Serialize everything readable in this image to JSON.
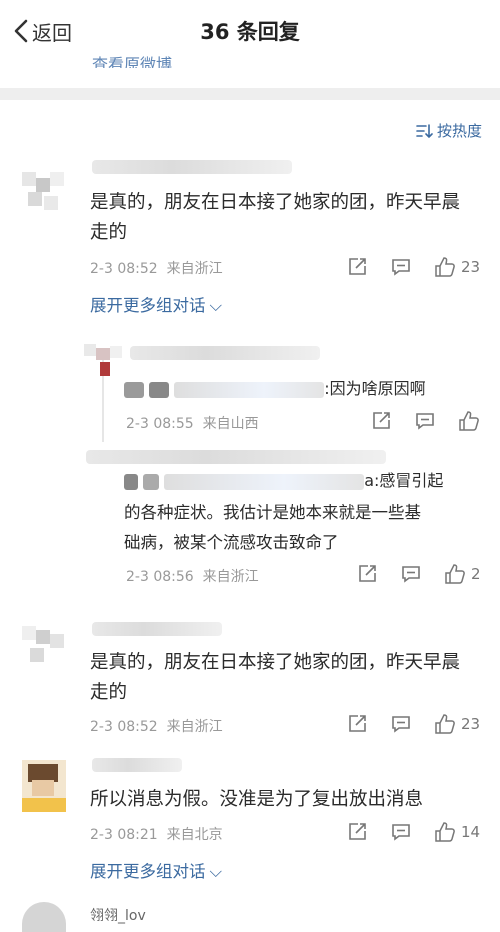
{
  "nav": {
    "back_label": "返回",
    "title": "36 条回复",
    "origin_link": "查看原微博",
    "sort_label": "按热度"
  },
  "comments": [
    {
      "text": "是真的，朋友在日本接了她家的团，昨天早晨走的",
      "time": "2-3 08:52",
      "location": "来自浙江",
      "likes": "23",
      "expand": "展开更多组对话"
    },
    {
      "reply_text": ":因为啥原因啊",
      "time": "2-3 08:55",
      "location": "来自山西",
      "likes": ""
    },
    {
      "reply_text": "a:感冒引起的各种症状。我估计是她本来就是一些基础病，被某个流感攻击致命了",
      "reply_line1": "a:感冒引起",
      "reply_line2": "的各种症状。我估计是她本来就是一些基",
      "reply_line3": "础病，被某个流感攻击致命了",
      "time": "2-3 08:56",
      "location": "来自浙江",
      "likes": "2"
    },
    {
      "text": "是真的，朋友在日本接了她家的团，昨天早晨走的",
      "time": "2-3 08:52",
      "location": "来自浙江",
      "likes": "23"
    },
    {
      "text": "所以消息为假。没准是为了复出放出消息",
      "time": "2-3 08:21",
      "location": "来自北京",
      "likes": "14",
      "expand": "展开更多组对话"
    }
  ],
  "c1": {
    "line1": "是真的，朋友在日本接了她家的团，昨天早晨",
    "line2": "走的"
  },
  "c4": {
    "line1": "是真的，朋友在日本接了她家的团，昨天早晨",
    "line2": "走的"
  },
  "bottom": {
    "name": "翎翎_lov"
  },
  "colors": {
    "link": "#3b6aa0",
    "meta": "#999999",
    "text": "#2b2b2b",
    "separator": "#eeeeee"
  }
}
